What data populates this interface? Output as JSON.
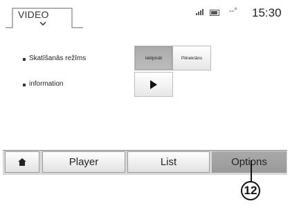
{
  "header": {
    "title": "VIDEO",
    "temperature": "--°",
    "time": "15:30"
  },
  "settings": {
    "rows": [
      {
        "label": "Skatīšanās režīms"
      },
      {
        "label": "information"
      }
    ],
    "view_mode": {
      "options": [
        "Ietilpināt",
        "Pilnekrāns"
      ],
      "selected": "Ietilpināt"
    }
  },
  "nav": {
    "tabs": [
      {
        "label": "Player"
      },
      {
        "label": "List"
      },
      {
        "label": "Options"
      }
    ],
    "active": "Options"
  },
  "callout": {
    "number": "12"
  }
}
